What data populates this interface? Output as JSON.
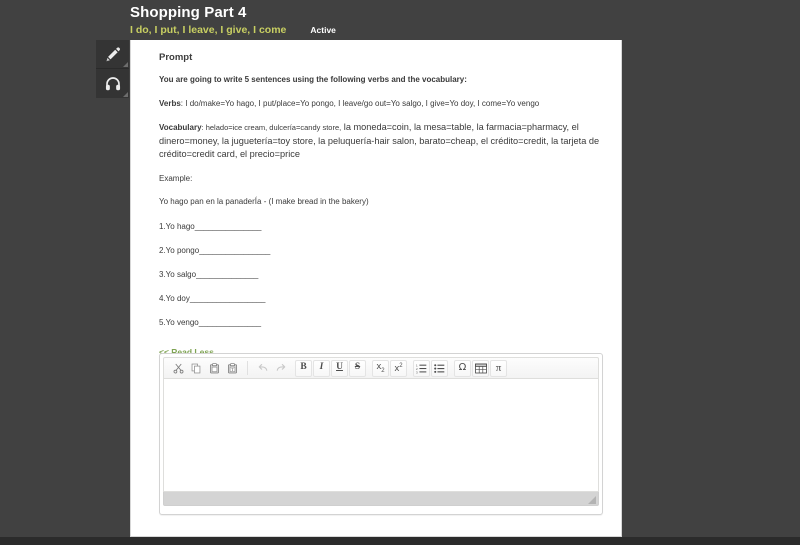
{
  "header": {
    "title": "Shopping Part 4",
    "subtitle": "I do, I put, I leave, I give, I come",
    "status": "Active"
  },
  "rail": {
    "items": [
      {
        "name": "pencil-tool",
        "icon": "pencil-icon"
      },
      {
        "name": "audio-tool",
        "icon": "headphones-icon"
      }
    ]
  },
  "prompt": {
    "heading": "Prompt",
    "intro": "You are going to write 5 sentences using the following verbs and the vocabulary:",
    "verbs_label": "Verbs",
    "verbs_text": ": I do/make=Yo hago, I put/place=Yo pongo, I leave/go out=Yo salgo, I give=Yo doy, I come=Yo vengo",
    "vocabulary_label": "Vocabulary",
    "vocabulary_small": ": helado=ice cream, dulcería=candy store,",
    "vocabulary_text": " la moneda=coin, la mesa=table, la farmacia=pharmacy, el dinero=money, la juguetería=toy store, la peluquería-hair salon, barato=cheap, el crédito=credit, la tarjeta de crédito=credit card, el precio=price",
    "example_label": "Example:",
    "example_text": "Yo hago pan en la panaderÍa - (I make bread in the bakery)",
    "answers": [
      "1.Yo hago_______________",
      "2.Yo pongo________________",
      "3.Yo salgo______________",
      "4.Yo doy_________________",
      "5.Yo vengo______________"
    ],
    "read_less": "<< Read Less"
  },
  "editor": {
    "toolbar_groups": [
      {
        "name": "clipboard",
        "buttons": [
          {
            "name": "cut-button",
            "icon": "scissors-icon",
            "label": "",
            "framed": false,
            "disabled": false
          },
          {
            "name": "copy-button",
            "icon": "copy-icon",
            "label": "",
            "framed": false,
            "disabled": false
          },
          {
            "name": "paste-button",
            "icon": "paste-icon",
            "label": "",
            "framed": false,
            "disabled": false
          },
          {
            "name": "paste-as-text-button",
            "icon": "paste-text-icon",
            "label": "",
            "framed": false,
            "disabled": false
          }
        ]
      },
      {
        "name": "history",
        "buttons": [
          {
            "name": "undo-button",
            "icon": "undo-arrow-icon",
            "label": "",
            "framed": false,
            "disabled": true
          },
          {
            "name": "redo-button",
            "icon": "redo-arrow-icon",
            "label": "",
            "framed": false,
            "disabled": true
          }
        ]
      },
      {
        "name": "basic-styles",
        "buttons": [
          {
            "name": "bold-button",
            "icon": "bold-icon",
            "label": "B",
            "framed": true,
            "disabled": false
          },
          {
            "name": "italic-button",
            "icon": "italic-icon",
            "label": "I",
            "framed": true,
            "disabled": false
          },
          {
            "name": "underline-button",
            "icon": "underline-icon",
            "label": "U",
            "framed": true,
            "disabled": false
          },
          {
            "name": "strikethrough-button",
            "icon": "strikethrough-icon",
            "label": "S",
            "framed": true,
            "disabled": false
          }
        ]
      },
      {
        "name": "script",
        "buttons": [
          {
            "name": "subscript-button",
            "icon": "subscript-icon",
            "label": "x",
            "framed": true,
            "disabled": false
          },
          {
            "name": "superscript-button",
            "icon": "superscript-icon",
            "label": "x",
            "framed": true,
            "disabled": false
          }
        ]
      },
      {
        "name": "lists",
        "buttons": [
          {
            "name": "numbered-list-button",
            "icon": "numbered-list-icon",
            "label": "",
            "framed": true,
            "disabled": false
          },
          {
            "name": "bulleted-list-button",
            "icon": "bulleted-list-icon",
            "label": "",
            "framed": true,
            "disabled": false
          }
        ]
      },
      {
        "name": "insert",
        "buttons": [
          {
            "name": "special-character-button",
            "icon": "omega-icon",
            "label": "Ω",
            "framed": true,
            "disabled": false
          },
          {
            "name": "table-button",
            "icon": "table-icon",
            "label": "",
            "framed": true,
            "disabled": false
          },
          {
            "name": "math-button",
            "icon": "pi-icon",
            "label": "π",
            "framed": true,
            "disabled": false
          }
        ]
      }
    ],
    "body_value": "",
    "body_placeholder": ""
  },
  "colors": {
    "page_background": "#414141",
    "panel_background": "#ffffff",
    "accent_subtitle": "#c8cf62",
    "link_green": "#7ea352",
    "footer_strip": "#2b2b2b"
  }
}
